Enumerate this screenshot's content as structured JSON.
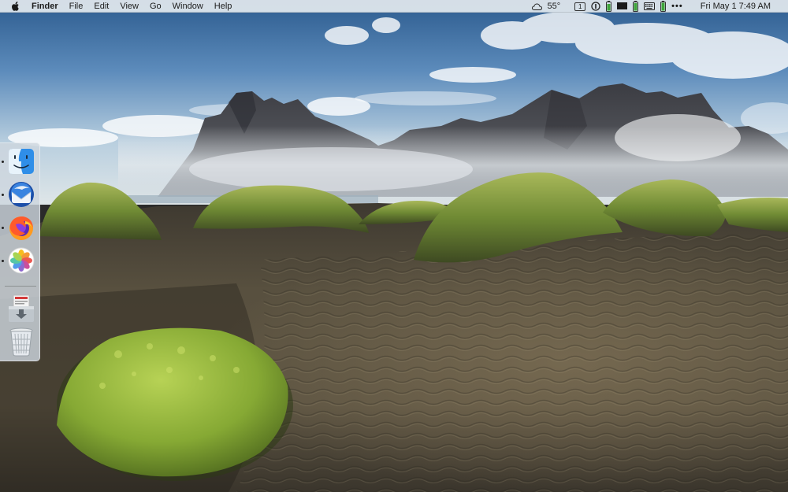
{
  "menubar": {
    "app_name": "Finder",
    "menus": [
      "File",
      "Edit",
      "View",
      "Go",
      "Window",
      "Help"
    ],
    "status": {
      "weather": "55°",
      "desktop_number": "1",
      "datetime": "Fri May 1  7:49 AM",
      "more": "•••"
    },
    "icons": [
      "apple-icon",
      "weather-cloud-icon",
      "desktop-number-icon",
      "one-password-icon",
      "battery-icon",
      "monitor-icon",
      "battery-icon-2",
      "keyboard-icon",
      "menu-extras-icon"
    ]
  },
  "dock": {
    "items": [
      {
        "name": "Finder",
        "icon": "finder-icon",
        "running": true
      },
      {
        "name": "Thunderbird",
        "icon": "thunderbird-icon",
        "running": true
      },
      {
        "name": "Firefox",
        "icon": "firefox-icon",
        "running": true
      },
      {
        "name": "Photos",
        "icon": "photos-icon",
        "running": true
      },
      {
        "name": "Downloads",
        "icon": "downloads-stack-icon",
        "running": false
      },
      {
        "name": "Trash",
        "icon": "trash-icon",
        "running": false
      }
    ]
  },
  "colors": {
    "menubar_bg": "#e2e8ee",
    "dock_bg": "#cdd6de",
    "sky_top": "#2f5f93",
    "sand": "#4d4638",
    "moss": "#8fb13a"
  }
}
